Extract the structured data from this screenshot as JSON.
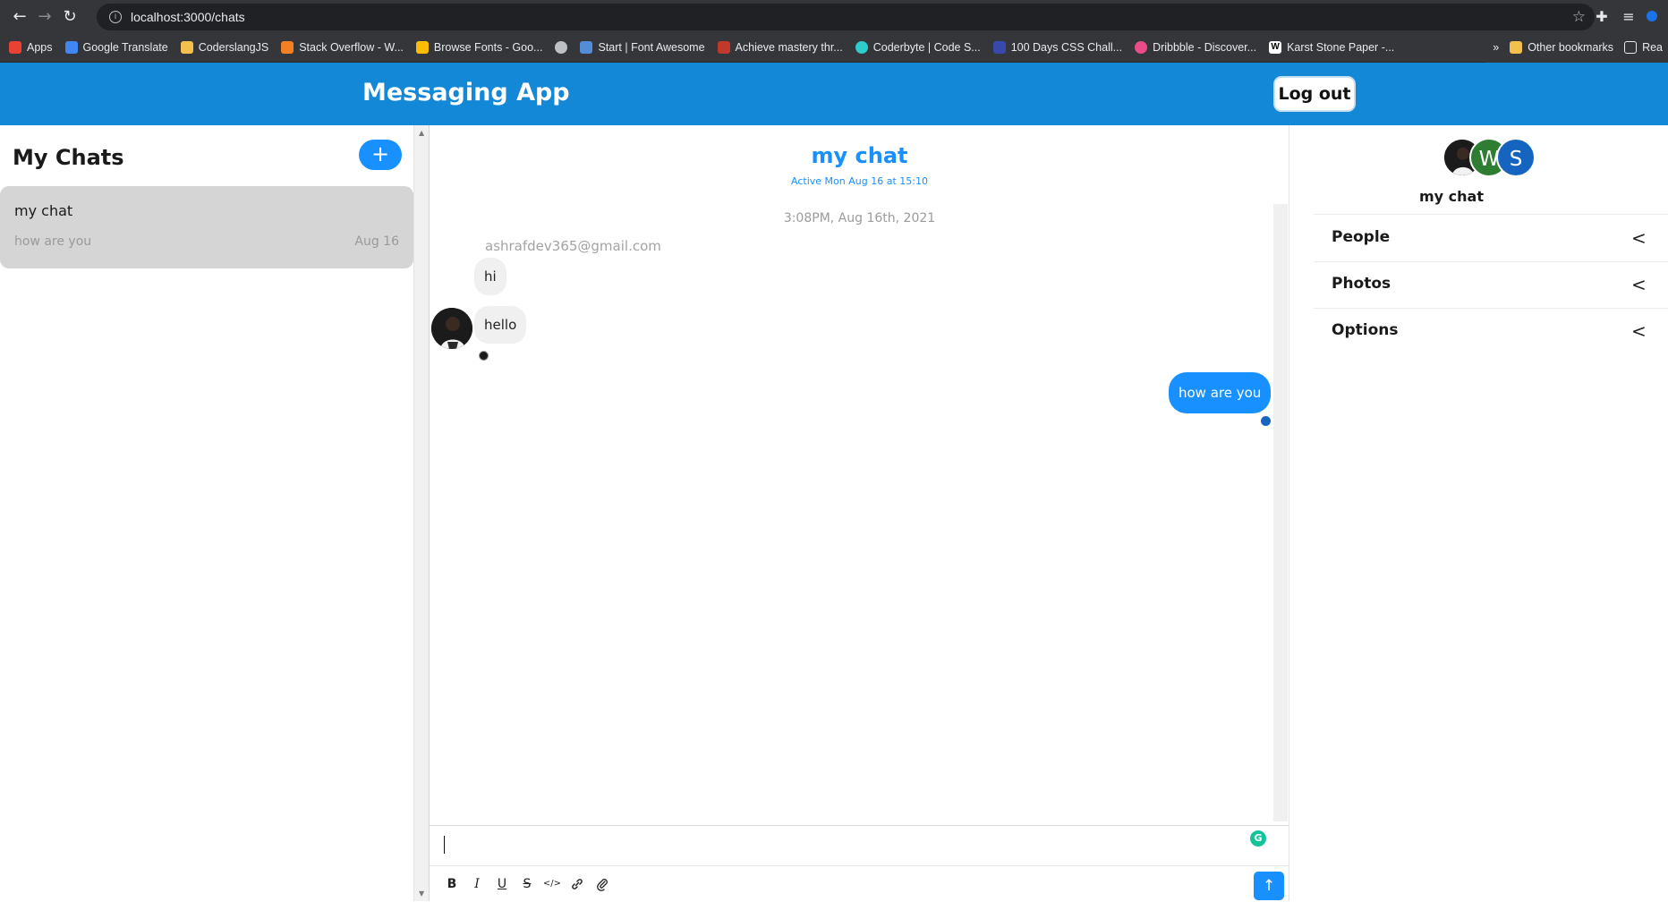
{
  "browser": {
    "url": "localhost:3000/chats",
    "bookmarks": [
      {
        "label": "Apps",
        "color": "#e94235"
      },
      {
        "label": "Google Translate",
        "color": "#4285f4"
      },
      {
        "label": "CoderslangJS",
        "color": "#f2c04d"
      },
      {
        "label": "Stack Overflow - W...",
        "color": "#f48024"
      },
      {
        "label": "Browse Fonts - Goo...",
        "color": "#fbbc05"
      },
      {
        "label": "",
        "color": "#bdc1c6"
      },
      {
        "label": "Start | Font Awesome",
        "color": "#538dd7"
      },
      {
        "label": "Achieve mastery thr...",
        "color": "#c0392b"
      },
      {
        "label": "Coderbyte | Code S...",
        "color": "#2ecccd"
      },
      {
        "label": "100 Days CSS Chall...",
        "color": "#3949ab"
      },
      {
        "label": "Dribbble - Discover...",
        "color": "#ea4c89"
      },
      {
        "label": "Karst Stone Paper -...",
        "color": "#ffffff"
      }
    ],
    "more_bookmarks": "»",
    "other_bookmarks": "Other bookmarks",
    "reading_list": "Rea"
  },
  "header": {
    "title": "Messaging App",
    "logout_label": "Log out"
  },
  "sidebar": {
    "title": "My Chats",
    "new_chat_icon": "+",
    "chats": [
      {
        "name": "my chat",
        "last_message": "how are you",
        "date": "Aug 16"
      }
    ]
  },
  "chat": {
    "title": "my chat",
    "status": "Active Mon Aug 16 at 15:10",
    "timestamp": "3:08PM, Aug 16th, 2021",
    "sender": "ashrafdev365@gmail.com",
    "messages": [
      {
        "text": "hi",
        "direction": "in"
      },
      {
        "text": "hello",
        "direction": "in"
      },
      {
        "text": "how are you",
        "direction": "out"
      }
    ],
    "composer": {
      "placeholder": "",
      "tools": [
        "B",
        "I",
        "U",
        "S",
        "</>",
        "link-icon",
        "attach-icon"
      ],
      "send_icon": "↑"
    }
  },
  "details": {
    "avatars": [
      {
        "letter": "",
        "color": "#1b1b1b"
      },
      {
        "letter": "W",
        "color": "#2e7d32"
      },
      {
        "letter": "S",
        "color": "#1565c0"
      }
    ],
    "name": "my chat",
    "sections": [
      "People",
      "Photos",
      "Options"
    ]
  },
  "colors": {
    "header_bg": "#1388d6",
    "accent": "#1890ff",
    "selected_chat_bg": "#d5d5d5"
  }
}
